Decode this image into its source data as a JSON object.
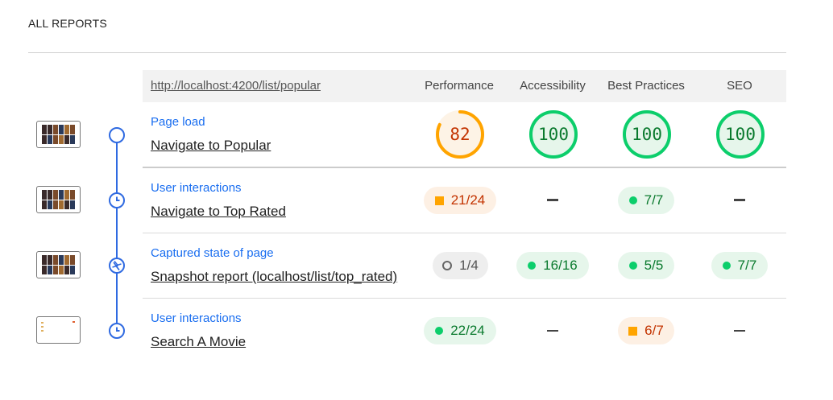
{
  "heading": "ALL REPORTS",
  "table": {
    "url": "http://localhost:4200/list/popular",
    "columns": [
      "Performance",
      "Accessibility",
      "Best Practices",
      "SEO"
    ]
  },
  "steps": [
    {
      "mode": "Page load",
      "title": "Navigate to Popular",
      "icon": "circle-icon",
      "scores": [
        {
          "type": "gauge",
          "value": "82",
          "fraction": 0.82,
          "status": "average"
        },
        {
          "type": "gauge",
          "value": "100",
          "fraction": 1.0,
          "status": "pass"
        },
        {
          "type": "gauge",
          "value": "100",
          "fraction": 1.0,
          "status": "pass"
        },
        {
          "type": "gauge",
          "value": "100",
          "fraction": 1.0,
          "status": "pass"
        }
      ]
    },
    {
      "mode": "User interactions",
      "title": "Navigate to Top Rated",
      "icon": "clock-icon",
      "scores": [
        {
          "type": "fraction",
          "value": "21/24",
          "status": "average"
        },
        {
          "type": "none"
        },
        {
          "type": "fraction",
          "value": "7/7",
          "status": "pass"
        },
        {
          "type": "none"
        }
      ]
    },
    {
      "mode": "Captured state of page",
      "title": "Snapshot report (localhost/list/top_rated)",
      "icon": "camera-shutter-icon",
      "scores": [
        {
          "type": "fraction",
          "value": "1/4",
          "status": "na"
        },
        {
          "type": "fraction",
          "value": "16/16",
          "status": "pass"
        },
        {
          "type": "fraction",
          "value": "5/5",
          "status": "pass"
        },
        {
          "type": "fraction",
          "value": "7/7",
          "status": "pass"
        }
      ]
    },
    {
      "mode": "User interactions",
      "title": "Search A Movie",
      "icon": "clock-icon",
      "scores": [
        {
          "type": "fraction",
          "value": "22/24",
          "status": "pass"
        },
        {
          "type": "none"
        },
        {
          "type": "fraction",
          "value": "6/7",
          "status": "average"
        },
        {
          "type": "none"
        }
      ]
    }
  ],
  "colors": {
    "pass": "#0cce6b",
    "pass_text": "#0a7a2e",
    "average": "#ffa400",
    "average_text": "#c33300",
    "timeline": "#2f6ae1",
    "link": "#1a6ef0"
  }
}
